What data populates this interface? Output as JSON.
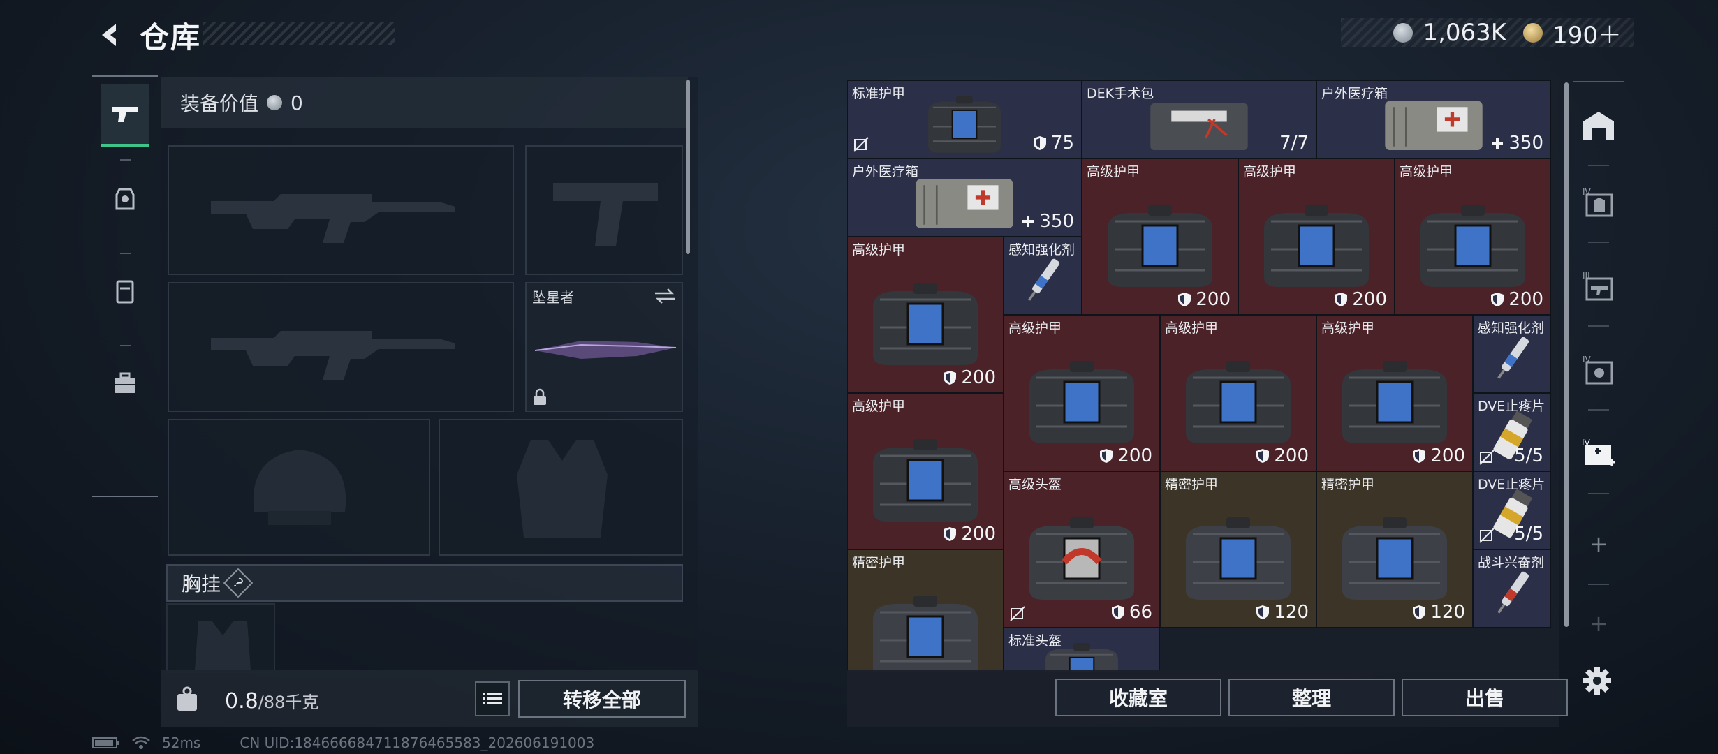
{
  "header": {
    "title": "仓库",
    "currencies": [
      {
        "icon": "silver-coin-icon",
        "value": "1,063K"
      },
      {
        "icon": "gold-coin-icon",
        "value": "190＋"
      }
    ]
  },
  "loadout": {
    "equip_value_label": "装备价值",
    "equip_value": "0",
    "melee_name": "坠星者",
    "chest_label": "胸挂",
    "chest_help": "?"
  },
  "footer_left": {
    "weight_value": "0.8",
    "weight_capacity": "/88千克",
    "transfer_all": "转移全部"
  },
  "footer_right": {
    "collection": "收藏室",
    "sort": "整理",
    "sell": "出售"
  },
  "stash_items": [
    {
      "name": "标准护甲",
      "value": "75",
      "value_icon": "shield-icon",
      "flag": true,
      "color": "blue",
      "art": "armor-blue"
    },
    {
      "name": "DEK手术包",
      "value": "7/7",
      "value_icon": "",
      "flag": false,
      "color": "blue",
      "art": "medkit"
    },
    {
      "name": "户外医疗箱",
      "value": "350",
      "value_icon": "plus-icon",
      "flag": false,
      "color": "blue",
      "art": "medbox"
    },
    {
      "name": "户外医疗箱",
      "value": "350",
      "value_icon": "plus-icon",
      "flag": false,
      "color": "blue",
      "art": "medbox"
    },
    {
      "name": "高级护甲",
      "value": "200",
      "value_icon": "shield-icon",
      "flag": false,
      "color": "red",
      "art": "armor-blue"
    },
    {
      "name": "高级护甲",
      "value": "200",
      "value_icon": "shield-icon",
      "flag": false,
      "color": "red",
      "art": "armor-blue"
    },
    {
      "name": "高级护甲",
      "value": "200",
      "value_icon": "shield-icon",
      "flag": false,
      "color": "red",
      "art": "armor-blue"
    },
    {
      "name": "高级护甲",
      "value": "200",
      "value_icon": "shield-icon",
      "flag": false,
      "color": "red",
      "art": "armor-blue"
    },
    {
      "name": "感知强化剂",
      "value": "",
      "value_icon": "",
      "flag": false,
      "color": "blue",
      "art": "injector"
    },
    {
      "name": "高级护甲",
      "value": "200",
      "value_icon": "shield-icon",
      "flag": false,
      "color": "red",
      "art": "armor-blue"
    },
    {
      "name": "高级护甲",
      "value": "200",
      "value_icon": "shield-icon",
      "flag": false,
      "color": "red",
      "art": "armor-blue"
    },
    {
      "name": "高级护甲",
      "value": "200",
      "value_icon": "shield-icon",
      "flag": false,
      "color": "red",
      "art": "armor-blue"
    },
    {
      "name": "感知强化剂",
      "value": "",
      "value_icon": "",
      "flag": false,
      "color": "blue",
      "art": "injector"
    },
    {
      "name": "高级护甲",
      "value": "200",
      "value_icon": "shield-icon",
      "flag": false,
      "color": "red",
      "art": "armor-blue"
    },
    {
      "name": "DVE止疼片",
      "value": "5/5",
      "value_icon": "",
      "flag": true,
      "color": "blue",
      "art": "pills"
    },
    {
      "name": "高级头盔",
      "value": "66",
      "value_icon": "shield-icon",
      "flag": true,
      "color": "red",
      "art": "armor-red"
    },
    {
      "name": "精密护甲",
      "value": "120",
      "value_icon": "shield-icon",
      "flag": false,
      "color": "gold",
      "art": "armor-grey"
    },
    {
      "name": "精密护甲",
      "value": "120",
      "value_icon": "shield-icon",
      "flag": false,
      "color": "gold",
      "art": "armor-grey"
    },
    {
      "name": "DVE止疼片",
      "value": "5/5",
      "value_icon": "",
      "flag": true,
      "color": "blue",
      "art": "pills"
    },
    {
      "name": "精密护甲",
      "value": "",
      "value_icon": "",
      "flag": false,
      "color": "gold",
      "art": "armor-grey"
    },
    {
      "name": "战斗兴奋剂",
      "value": "",
      "value_icon": "",
      "flag": false,
      "color": "blue",
      "art": "stim"
    },
    {
      "name": "标准头盔",
      "value": "",
      "value_icon": "",
      "flag": false,
      "color": "blue",
      "art": "armor-grey"
    }
  ],
  "status_bar": {
    "ping": "52ms",
    "uid": "CN UID:1846666847118764655​83_202606191003"
  },
  "colors": {
    "accent_green": "#3fc48a",
    "cell_blue": "#2b2f47",
    "cell_red": "#4a2228",
    "cell_gold": "#3b3427"
  }
}
